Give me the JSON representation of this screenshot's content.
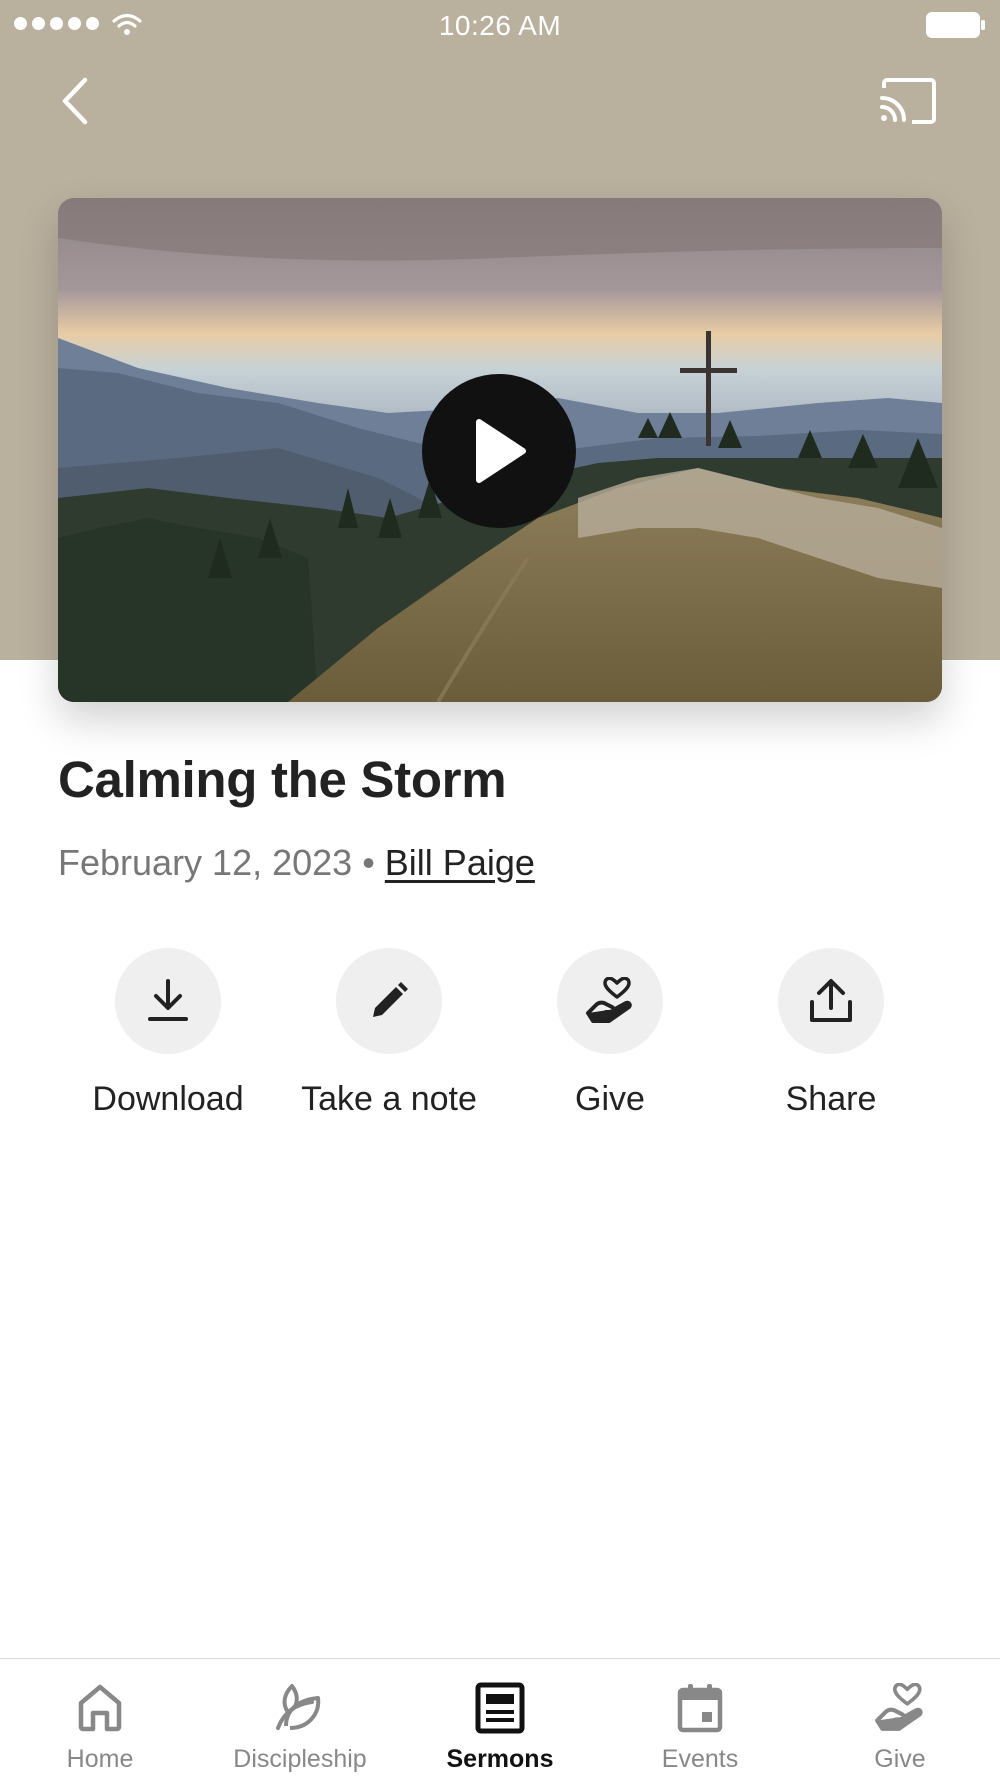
{
  "status_bar": {
    "time": "10:26 AM"
  },
  "colors": {
    "header_background": "#bab09e",
    "accent_active_tab": "#111111",
    "inactive_tab": "#888888",
    "action_circle": "#efefef"
  },
  "navigation": {
    "back_icon": "chevron-left-icon",
    "cast_icon": "cast-icon"
  },
  "video": {
    "play_icon": "play-icon"
  },
  "sermon": {
    "title": "Calming the Storm",
    "date": "February 12, 2023",
    "separator": "•",
    "speaker": "Bill Paige"
  },
  "actions": [
    {
      "label": "Download",
      "icon": "download-icon"
    },
    {
      "label": "Take a note",
      "icon": "pencil-icon"
    },
    {
      "label": "Give",
      "icon": "heart-hand-icon"
    },
    {
      "label": "Share",
      "icon": "share-icon"
    }
  ],
  "tabs": [
    {
      "label": "Home",
      "icon": "home-icon",
      "active": false
    },
    {
      "label": "Discipleship",
      "icon": "leaf-icon",
      "active": false
    },
    {
      "label": "Sermons",
      "icon": "sermons-icon",
      "active": true
    },
    {
      "label": "Events",
      "icon": "calendar-icon",
      "active": false
    },
    {
      "label": "Give",
      "icon": "heart-hand-icon",
      "active": false
    }
  ]
}
